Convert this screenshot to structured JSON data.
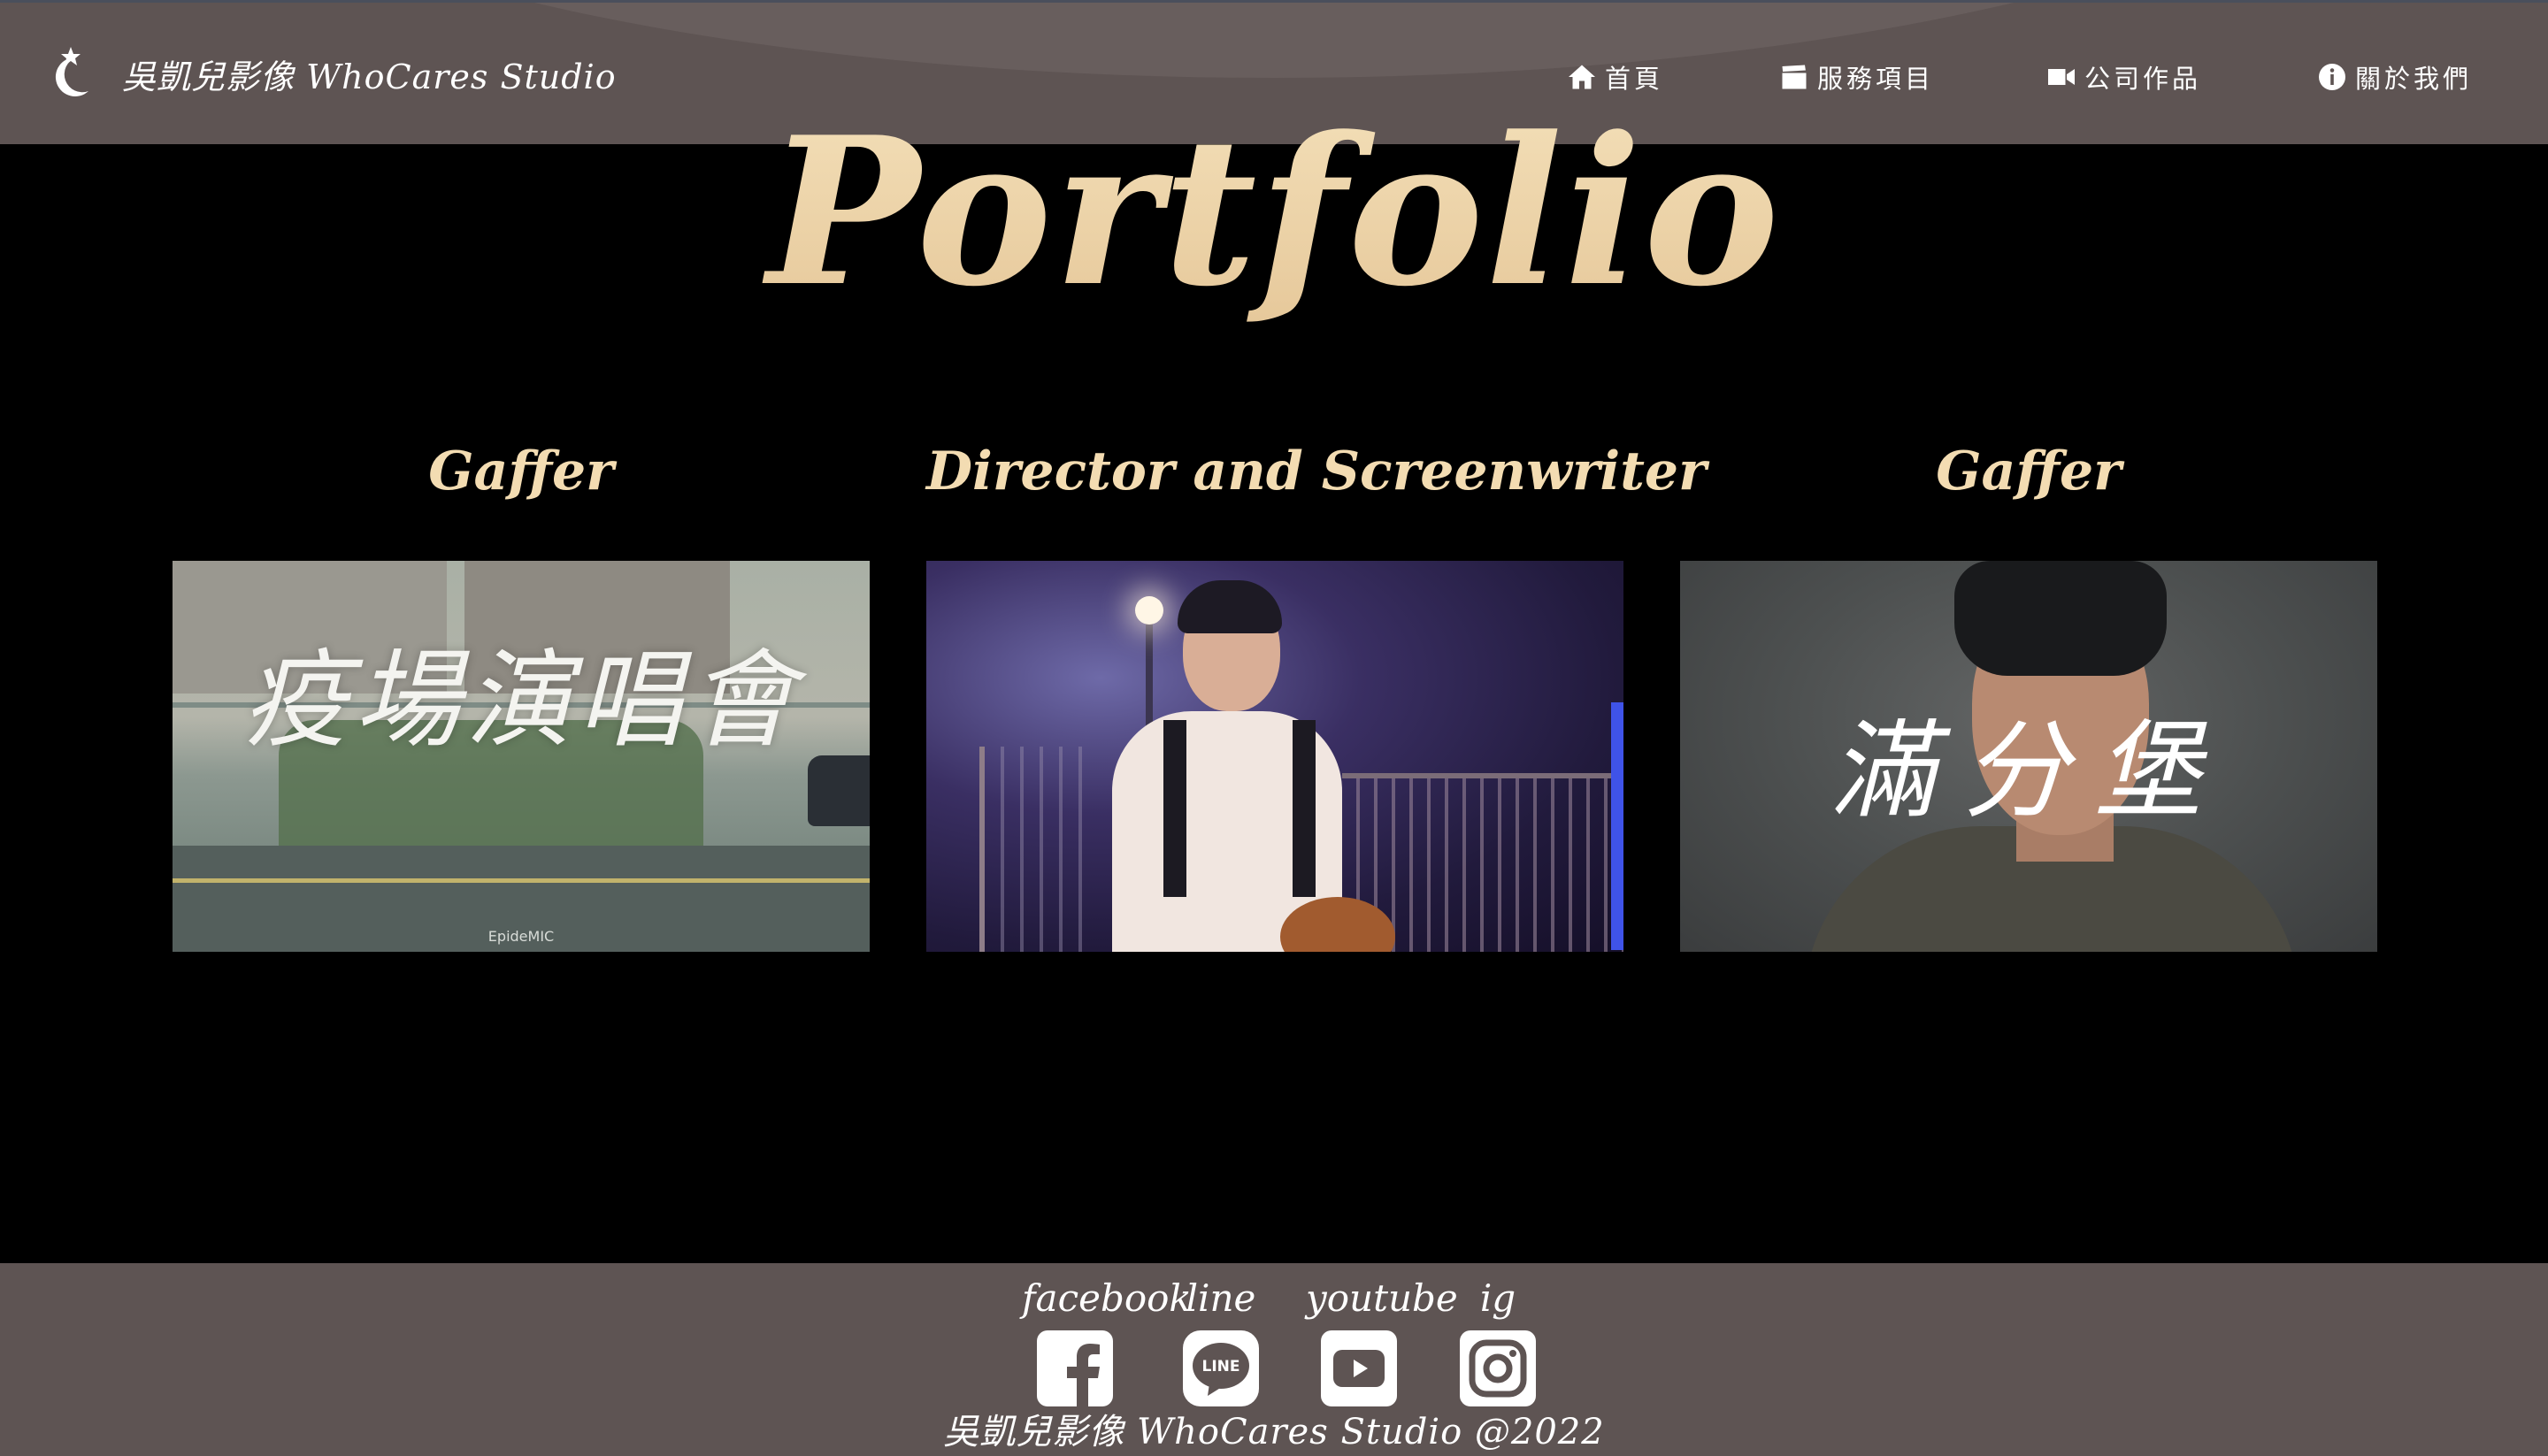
{
  "brand": {
    "name": "吳凱兒影像 WhoCares Studio",
    "logo_icon": "crescent-star-logo-icon"
  },
  "nav": {
    "items": [
      {
        "label": "首頁",
        "icon": "home-icon"
      },
      {
        "label": "服務項目",
        "icon": "clapperboard-icon"
      },
      {
        "label": "公司作品",
        "icon": "video-camera-icon"
      },
      {
        "label": "關於我們",
        "icon": "info-circle-icon"
      }
    ]
  },
  "main": {
    "title": "Portfolio",
    "works": [
      {
        "role": "Gaffer",
        "thumb_title": "疫場演唱會",
        "thumb_caption": "EpideMIC"
      },
      {
        "role": "Director and Screenwriter",
        "thumb_title": "",
        "thumb_caption": ""
      },
      {
        "role": "Gaffer",
        "thumb_title": "滿分堡",
        "thumb_caption": ""
      }
    ]
  },
  "footer": {
    "socials": [
      {
        "label": "facebook",
        "icon": "facebook-icon"
      },
      {
        "label": "line",
        "icon": "line-icon"
      },
      {
        "label": "youtube",
        "icon": "youtube-icon"
      },
      {
        "label": "ig",
        "icon": "instagram-icon"
      }
    ],
    "copyright": "吳凱兒影像 WhoCares Studio @2022"
  },
  "colors": {
    "nav_bg": "#5e5453",
    "page_bg": "#000000",
    "title_gold": "#f3dcb2"
  }
}
